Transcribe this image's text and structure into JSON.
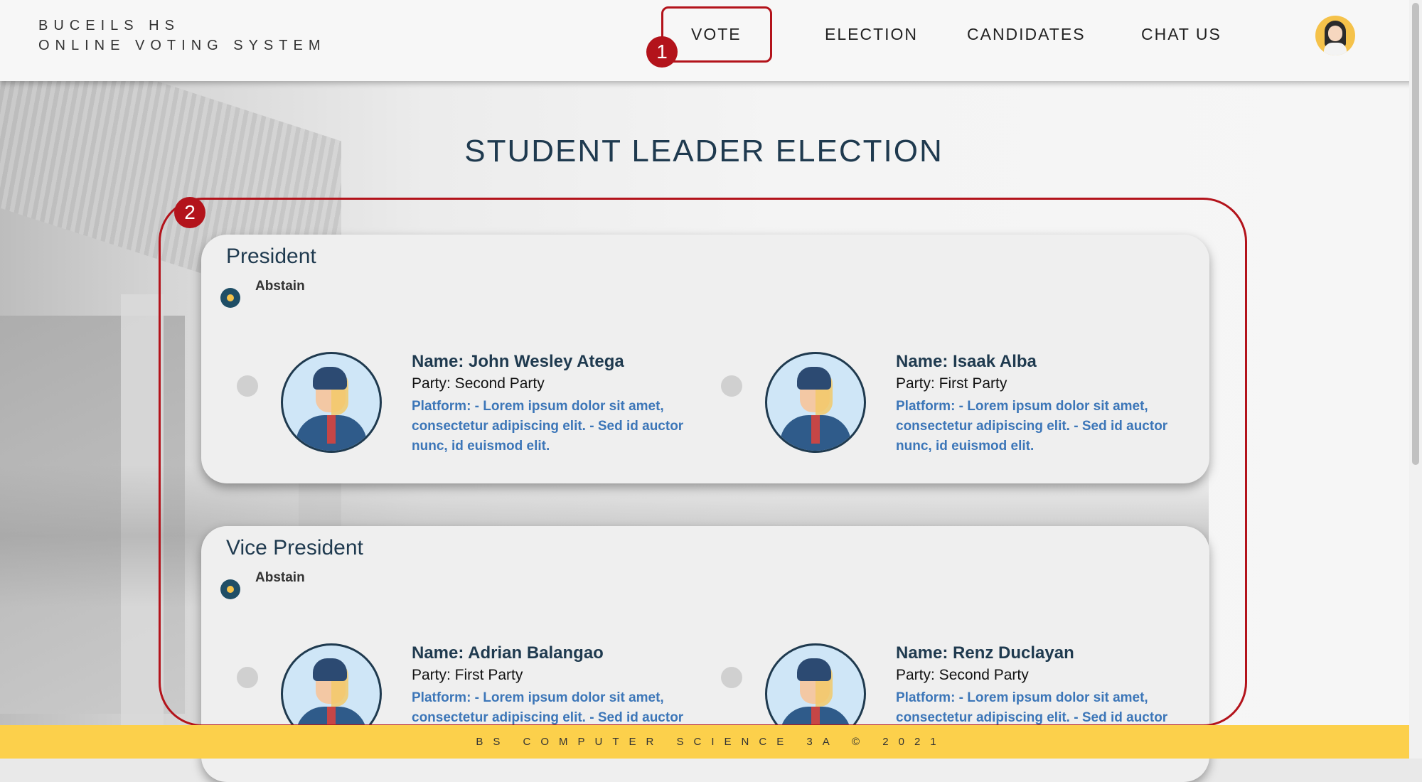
{
  "header": {
    "brand_line1": "BUCEILS HS",
    "brand_line2": "ONLINE VOTING SYSTEM",
    "nav": [
      "VOTE",
      "ELECTION",
      "CANDIDATES",
      "CHAT US"
    ],
    "avatar_icon": "user-avatar-icon"
  },
  "annotations": {
    "badge1": "1",
    "badge2": "2",
    "color": "#b3131b"
  },
  "page_title": "STUDENT LEADER ELECTION",
  "positions": [
    {
      "title": "President",
      "abstain_label": "Abstain",
      "candidates": [
        {
          "name": "Name: John Wesley Atega",
          "party": "Party: Second Party",
          "platform": "Platform: - Lorem ipsum dolor sit amet, consectetur adipiscing elit. - Sed id auctor nunc, id euismod elit."
        },
        {
          "name": "Name: Isaak Alba",
          "party": "Party: First Party",
          "platform": "Platform: - Lorem ipsum dolor sit amet, consectetur adipiscing elit. - Sed id auctor nunc, id euismod elit."
        }
      ]
    },
    {
      "title": "Vice President",
      "abstain_label": "Abstain",
      "candidates": [
        {
          "name": "Name: Adrian Balangao",
          "party": "Party: First Party",
          "platform": "Platform: - Lorem ipsum dolor sit amet, consectetur adipiscing elit. - Sed id auctor"
        },
        {
          "name": "Name: Renz Duclayan",
          "party": "Party: Second Party",
          "platform": "Platform: - Lorem ipsum dolor sit amet, consectetur adipiscing elit. - Sed id auctor"
        }
      ]
    }
  ],
  "footer": "BS COMPUTER SCIENCE 3A © 2021",
  "colors": {
    "accent": "#fcd04b",
    "navy": "#1f3a4f",
    "platform_blue": "#3c76b8"
  }
}
